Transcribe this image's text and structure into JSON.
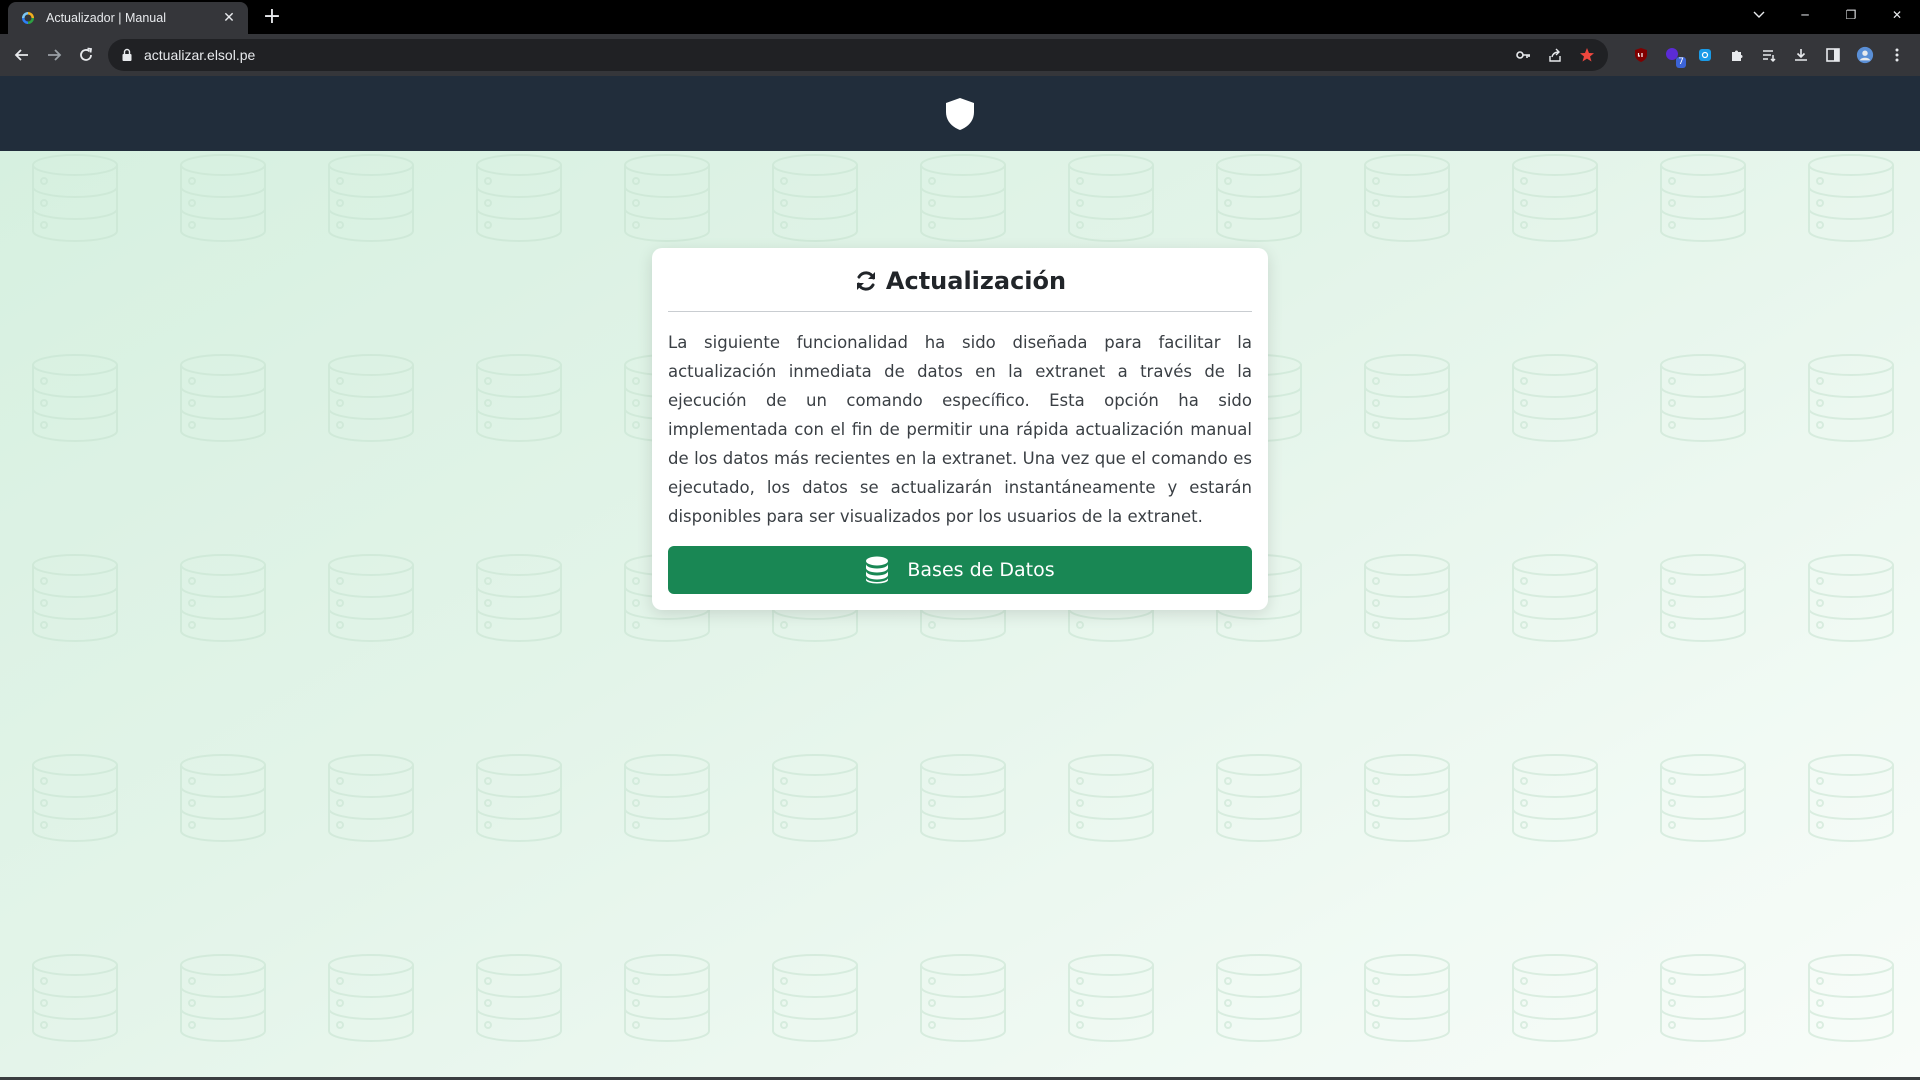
{
  "browser": {
    "tab_title": "Actualizador | Manual",
    "tab_close": "✕",
    "new_tab": "+",
    "url": "actualizar.elsol.pe",
    "window_controls": {
      "minimize": "─",
      "restore": "❐",
      "close": "✕"
    },
    "extension_badge": "7"
  },
  "card": {
    "title": "Actualización",
    "description": "La siguiente funcionalidad ha sido diseñada para facilitar la actualización inmediata de datos en la extranet a través de la ejecución de un comando específico. Esta opción ha sido implementada con el fin de permitir una rápida actualización manual de los datos más recientes en la extranet. Una vez que el comando es ejecutado, los datos se actualizarán instantáneamente y estarán disponibles para ser visualizados por los usuarios de la extranet.",
    "button_label": "Bases de Datos"
  },
  "colors": {
    "header_bg": "#212d3b",
    "button_bg": "#198754",
    "page_bg": "#e3f4e9"
  },
  "icons": {
    "header": "shield-icon",
    "title": "sync-icon",
    "button": "database-icon"
  }
}
